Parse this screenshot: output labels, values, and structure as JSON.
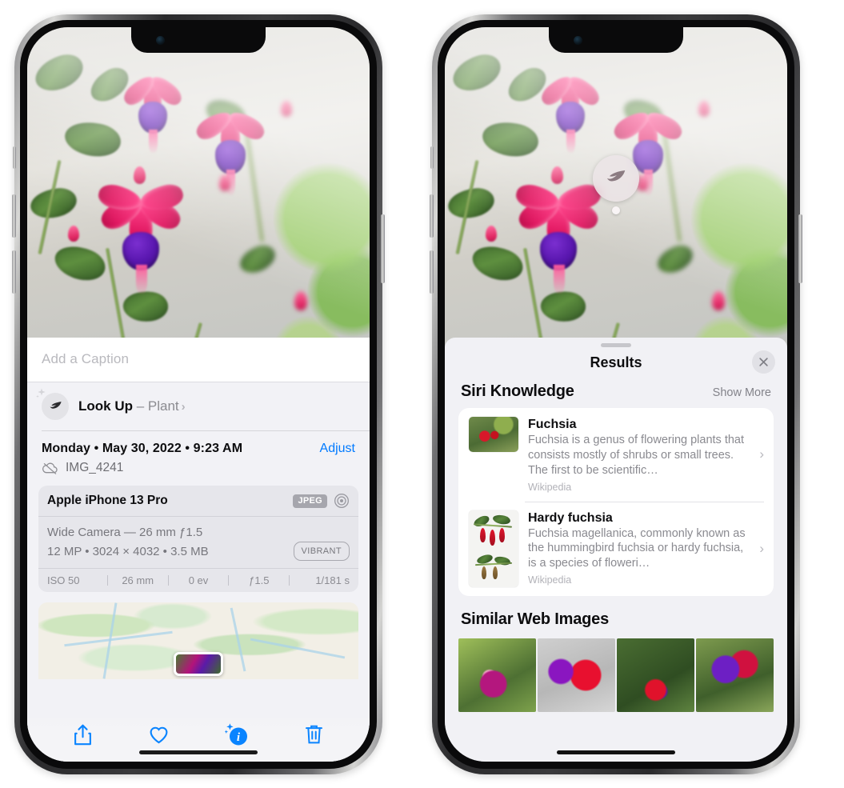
{
  "left_phone": {
    "name": "photos-detail-screen",
    "caption": {
      "placeholder": "Add a Caption",
      "value": ""
    },
    "lookup": {
      "title": "Look Up",
      "dash": " – ",
      "subject": "Plant",
      "chevron": "›",
      "icon": "leaf-icon"
    },
    "meta": {
      "date": "Monday • May 30, 2022 • 9:23 AM",
      "adjust_label": "Adjust",
      "filename": "IMG_4241",
      "cloud_icon": "icloud-slash-icon"
    },
    "camera_card": {
      "device": "Apple iPhone 13 Pro",
      "format_badge": "JPEG",
      "aperture_icon": "aperture-icon",
      "lens_line": "Wide Camera — 26 mm ƒ1.5",
      "specs_line": "12 MP • 3024 × 4032 • 3.5 MB",
      "style_badge": "VIBRANT",
      "exif": [
        "ISO 50",
        "26 mm",
        "0 ev",
        "ƒ1.5",
        "1/181 s"
      ]
    },
    "map": {
      "name": "location-map-thumbnail",
      "pin": "photo-pin"
    },
    "toolbar": [
      {
        "name": "share-button",
        "icon": "share-icon"
      },
      {
        "name": "favorite-button",
        "icon": "heart-icon"
      },
      {
        "name": "info-button",
        "icon": "info-sparkle-icon"
      },
      {
        "name": "delete-button",
        "icon": "trash-icon"
      }
    ]
  },
  "right_phone": {
    "name": "visual-lookup-results-screen",
    "visual_lookup_pin": {
      "icon": "leaf-icon",
      "label": "plant-indicator"
    },
    "sheet": {
      "grabber": "sheet-grabber",
      "title": "Results",
      "close_icon": "close-icon"
    },
    "siri_knowledge": {
      "section_title": "Siri Knowledge",
      "action_label": "Show More",
      "items": [
        {
          "title": "Fuchsia",
          "description": "Fuchsia is a genus of flowering plants that consists mostly of shrubs or small trees. The first to be scientific…",
          "source": "Wikipedia",
          "chevron": "›"
        },
        {
          "title": "Hardy fuchsia",
          "description": "Fuchsia magellanica, commonly known as the hummingbird fuchsia or hardy fuchsia, is a species of floweri…",
          "source": "Wikipedia",
          "chevron": "›"
        }
      ]
    },
    "similar_web_images": {
      "section_title": "Similar Web Images",
      "thumbnails": [
        "fuchsia-thumb-1",
        "fuchsia-thumb-2",
        "fuchsia-thumb-3",
        "fuchsia-thumb-4"
      ]
    }
  },
  "colors": {
    "accent_blue": "#007aff",
    "sheet_gray": "#f1f1f5",
    "card_gray": "#e6e6eb",
    "text_primary": "#0d0d0f",
    "text_secondary": "#8a8a90"
  }
}
